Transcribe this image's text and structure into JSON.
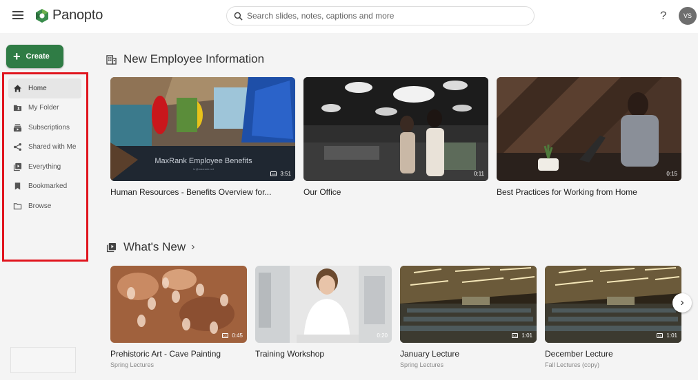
{
  "header": {
    "app_name": "Panopto",
    "search_placeholder": "Search slides, notes, captions and more",
    "help_label": "?",
    "avatar_initials": "VS"
  },
  "sidebar": {
    "create_label": "Create",
    "items": [
      {
        "label": "Home",
        "icon": "home-icon",
        "active": true
      },
      {
        "label": "My Folder",
        "icon": "folder-user-icon"
      },
      {
        "label": "Subscriptions",
        "icon": "subscriptions-icon"
      },
      {
        "label": "Shared with Me",
        "icon": "share-icon"
      },
      {
        "label": "Everything",
        "icon": "library-icon"
      },
      {
        "label": "Bookmarked",
        "icon": "bookmark-icon"
      },
      {
        "label": "Browse",
        "icon": "folder-icon"
      }
    ]
  },
  "sections": {
    "featured": {
      "title": "New Employee Information",
      "icon": "building-icon",
      "cards": [
        {
          "title": "Human Resources - Benefits Overview for...",
          "duration": "3:51",
          "overlay_title": "MaxRank Employee Benefits",
          "overlay_sub": "hr@maxrank.net"
        },
        {
          "title": "Our Office",
          "duration": "0:11"
        },
        {
          "title": "Best Practices for Working from Home",
          "duration": "0:15"
        }
      ]
    },
    "whats_new": {
      "title": "What's New",
      "chevron": "›",
      "icon": "playlist-icon",
      "cards": [
        {
          "title": "Prehistoric Art - Cave Painting",
          "subtitle": "Spring Lectures",
          "duration": "0:45"
        },
        {
          "title": "Training Workshop",
          "subtitle": "",
          "duration": "0:20"
        },
        {
          "title": "January Lecture",
          "subtitle": "Spring Lectures",
          "duration": "1:01"
        },
        {
          "title": "December Lecture",
          "subtitle": "Fall Lectures (copy)",
          "duration": "1:01"
        }
      ]
    }
  },
  "colors": {
    "create_button": "#2f7c45",
    "highlight_box": "#e0141d",
    "page_bg": "#f4f4f4"
  }
}
